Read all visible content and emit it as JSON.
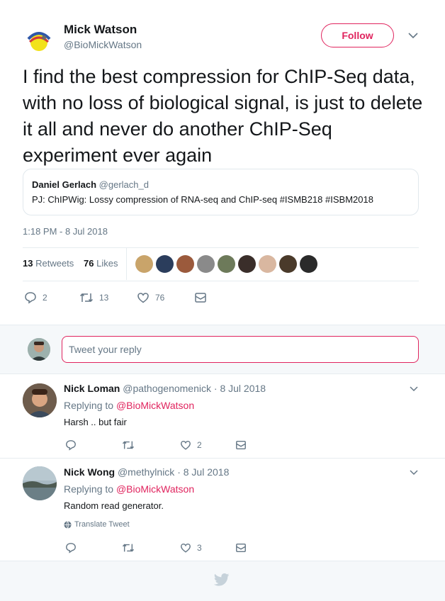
{
  "tweet": {
    "author_name": "Mick Watson",
    "author_handle": "@BioMickWatson",
    "follow_label": "Follow",
    "text": "I find the best compression for ChIP-Seq data, with no loss of biological signal, is just to delete it all and never do another ChIP-Seq experiment ever again",
    "quote": {
      "name": "Daniel Gerlach",
      "handle": "@gerlach_d",
      "text": "PJ: ChIPWig: Lossy compression of RNA-seq and ChIP-seq #ISMB218 #ISBM2018"
    },
    "timestamp": "1:18 PM - 8 Jul 2018",
    "stats": {
      "retweets_count": "13",
      "retweets_label": "Retweets",
      "likes_count": "76",
      "likes_label": "Likes"
    },
    "actions": {
      "replies": "2",
      "retweets": "13",
      "likes": "76"
    }
  },
  "reply_box": {
    "placeholder": "Tweet your reply"
  },
  "replies": [
    {
      "name": "Nick Loman",
      "handle": "@pathogenomenick",
      "date": "· 8 Jul 2018",
      "replying_prefix": "Replying to",
      "replying_to": "@BioMickWatson",
      "text": "Harsh .. but fair",
      "likes": "2"
    },
    {
      "name": "Nick Wong",
      "handle": "@methylnick",
      "date": "· 8 Jul 2018",
      "replying_prefix": "Replying to",
      "replying_to": "@BioMickWatson",
      "text": "Random read generator.",
      "translate": "Translate Tweet",
      "likes": "3"
    }
  ],
  "colors": {
    "accent": "#e0245e",
    "muted": "#657786",
    "divider": "#e6ecf0",
    "footer_bg": "#f5f8fa",
    "bird": "#c6d2da"
  },
  "icons": [
    "chevron-down-icon",
    "reply-icon",
    "retweet-icon",
    "heart-icon",
    "dm-icon",
    "globe-icon",
    "twitter-bird-icon"
  ]
}
